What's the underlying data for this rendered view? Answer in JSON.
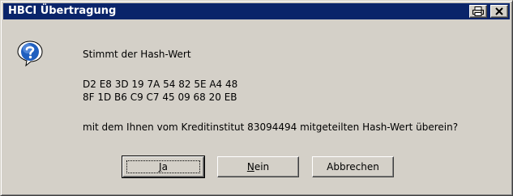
{
  "window": {
    "title": "HBCI Übertragung",
    "print_icon": "printer-icon",
    "close_glyph": "✕"
  },
  "message": {
    "icon": "question-icon",
    "question": "Stimmt der Hash-Wert",
    "hash_line_1": "D2 E8 3D 19 7A 54 82 5E A4 48",
    "hash_line_2": "8F 1D B6 C9 C7 45 09 68 20 EB",
    "confirm": "mit dem Ihnen vom Kreditinstitut 83094494 mitgeteilten Hash-Wert überein?"
  },
  "buttons": {
    "ja": {
      "mnemonic": "J",
      "rest": "a"
    },
    "nein": {
      "mnemonic": "N",
      "rest": "ein"
    },
    "abbrechen": "Abbrechen"
  },
  "colors": {
    "titlebar": "#0a246a",
    "dialog_face": "#d4d0c8",
    "icon_blue": "#1f5fbf"
  }
}
